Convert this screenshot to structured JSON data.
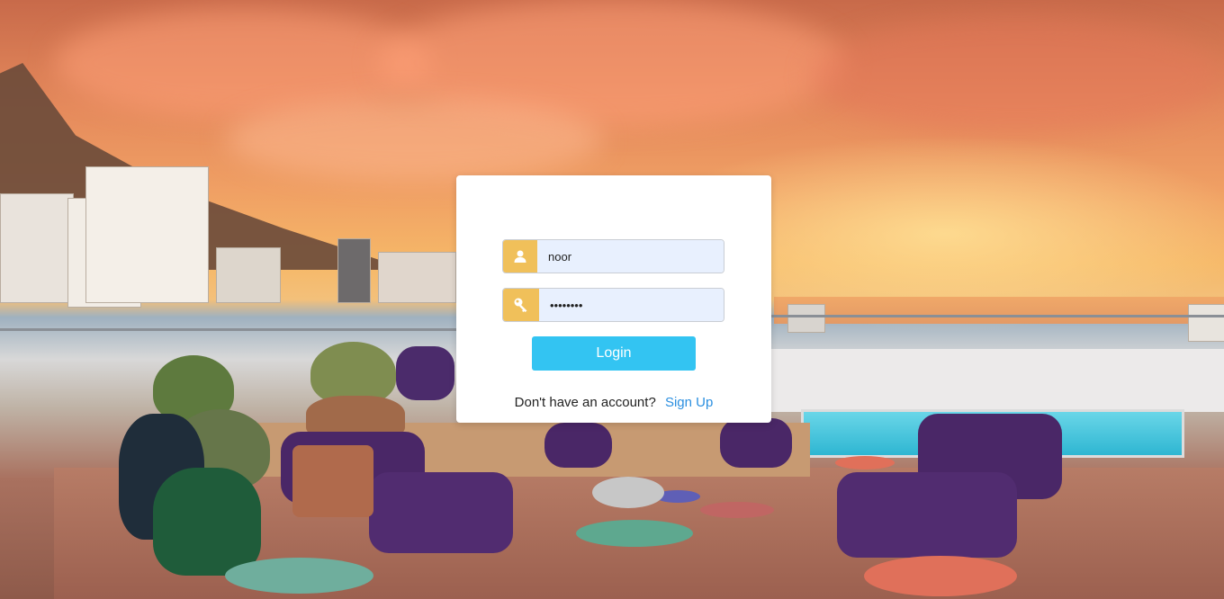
{
  "background": {
    "description_icon": "rooftop-terrace-photo"
  },
  "login": {
    "username_icon": "user-icon",
    "username_value": "noor",
    "password_icon": "key-icon",
    "password_value": "noor1234",
    "login_label": "Login",
    "signup_prompt": "Don't have an account?",
    "signup_link": "Sign Up"
  },
  "colors": {
    "addon": "#f0c05a",
    "button": "#33c4f2",
    "link": "#2b8fe0",
    "input_bg": "#e8f0fe"
  }
}
